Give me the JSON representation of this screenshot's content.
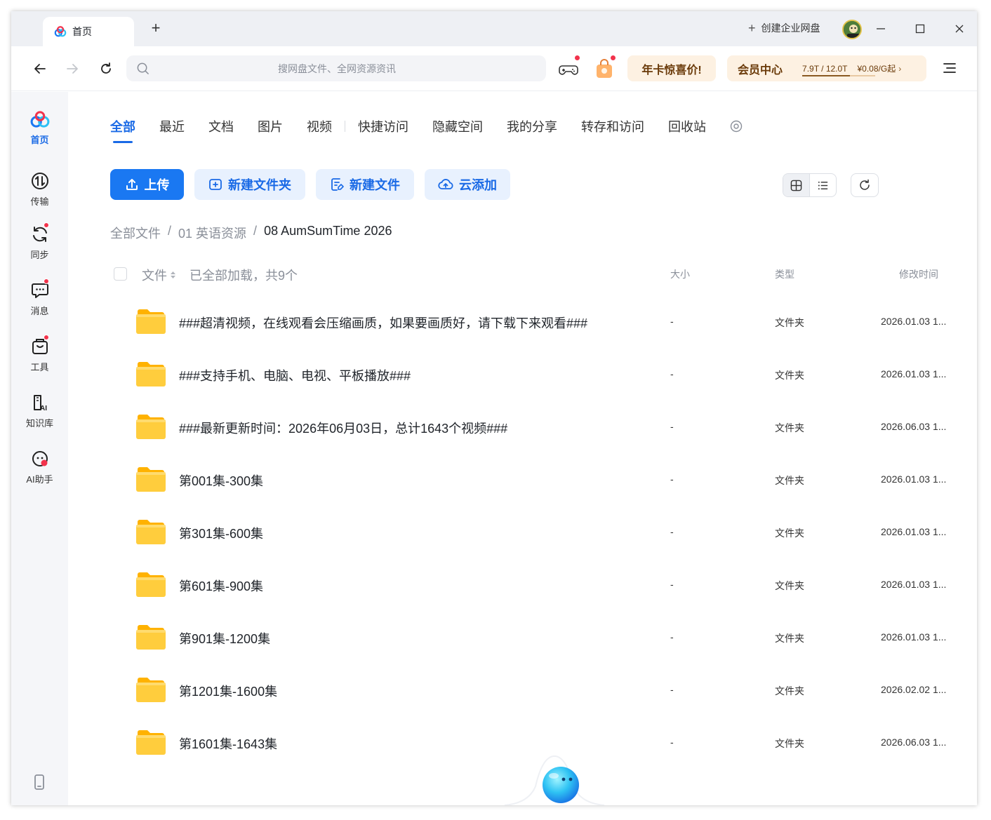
{
  "window": {
    "tab_label": "首页",
    "new_tab": "+",
    "create_enterprise": "创建企业网盘",
    "avatar_label": "SWP6"
  },
  "navbar": {
    "search_placeholder": "搜网盘文件、全网资源资讯",
    "promo": "年卡惊喜价!",
    "vip": {
      "title": "会员中心",
      "storage": "7.9T / 12.0T",
      "storage_used_fraction": 0.658,
      "price": "¥0.08/G起",
      "chevron": "›"
    }
  },
  "sidebar": {
    "items": [
      {
        "label": "首页",
        "icon": "home-logo-icon",
        "active": true
      },
      {
        "label": "传输",
        "icon": "transfer-icon"
      },
      {
        "label": "同步",
        "icon": "sync-icon",
        "dot": true
      },
      {
        "label": "消息",
        "icon": "message-icon",
        "dot": true
      },
      {
        "label": "工具",
        "icon": "toolbox-icon",
        "dot": true
      },
      {
        "label": "知识库",
        "icon": "knowledge-icon"
      },
      {
        "label": "AI助手",
        "icon": "ai-assistant-icon"
      }
    ]
  },
  "main": {
    "tabs": [
      "全部",
      "最近",
      "文档",
      "图片",
      "视频",
      "快捷访问",
      "隐藏空间",
      "我的分享",
      "转存和访问",
      "回收站"
    ],
    "actions": {
      "upload": "上传",
      "new_folder": "新建文件夹",
      "new_file": "新建文件",
      "cloud_add": "云添加"
    },
    "breadcrumb": {
      "root": "全部文件",
      "sep": "/",
      "level1": "01 英语资源",
      "current": "08 AumSumTime 2026"
    },
    "table": {
      "col_file": "文件",
      "loaded": "已全部加载，共9个",
      "col_size": "大小",
      "col_type": "类型",
      "col_time": "修改时间"
    },
    "files": [
      {
        "name": "###超清视频，在线观看会压缩画质，如果要画质好，请下载下来观看###",
        "size": "-",
        "type": "文件夹",
        "time": "2026.01.03 1..."
      },
      {
        "name": "###支持手机、电脑、电视、平板播放###",
        "size": "-",
        "type": "文件夹",
        "time": "2026.01.03 1..."
      },
      {
        "name": "###最新更新时间：2026年06月03日，总计1643个视频###",
        "size": "-",
        "type": "文件夹",
        "time": "2026.06.03 1..."
      },
      {
        "name": "第001集-300集",
        "size": "-",
        "type": "文件夹",
        "time": "2026.01.03 1..."
      },
      {
        "name": "第301集-600集",
        "size": "-",
        "type": "文件夹",
        "time": "2026.01.03 1..."
      },
      {
        "name": "第601集-900集",
        "size": "-",
        "type": "文件夹",
        "time": "2026.01.03 1..."
      },
      {
        "name": "第901集-1200集",
        "size": "-",
        "type": "文件夹",
        "time": "2026.01.03 1..."
      },
      {
        "name": "第1201集-1600集",
        "size": "-",
        "type": "文件夹",
        "time": "2026.02.02 1..."
      },
      {
        "name": "第1601集-1643集",
        "size": "-",
        "type": "文件夹",
        "time": "2026.06.03 1..."
      }
    ]
  },
  "colors": {
    "accent": "#1a6ae6",
    "primary_button": "#1a78f2",
    "secondary_button_bg": "#e8f1fe",
    "folder": "#ffc933",
    "promo_bg": "#fdf1e2",
    "red_dot": "#f2334c"
  }
}
